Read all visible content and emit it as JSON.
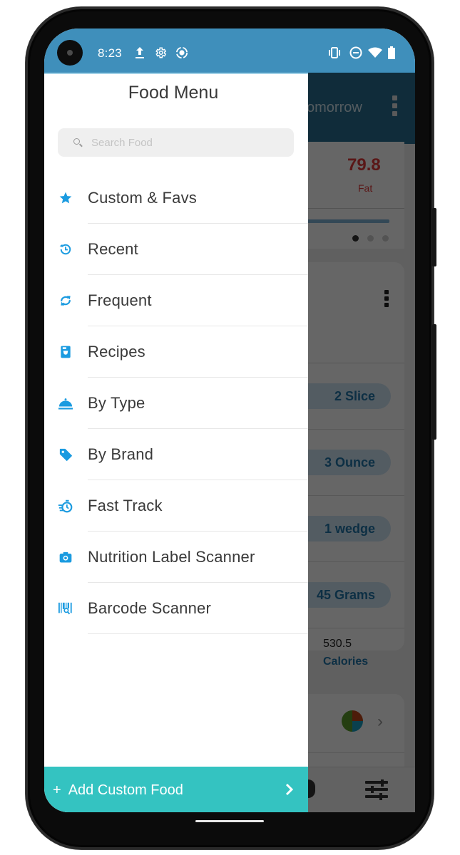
{
  "status_bar": {
    "time": "8:23",
    "left_icons": [
      "upload-icon",
      "settings-icon",
      "screen-record-icon"
    ],
    "right_icons": [
      "vibrate-icon",
      "do-not-disturb-icon",
      "wifi-icon",
      "battery-icon"
    ]
  },
  "background_app": {
    "header_text": "Tomorrow",
    "fat_value": "79.8",
    "fat_label": "Fat",
    "pager_dots": 3,
    "active_pager_dot": 0,
    "portions": [
      "2 Slice",
      "3 Ounce",
      "1 wedge",
      "45 Grams"
    ],
    "calories_value": "530.5",
    "calories_label": "Calories",
    "colors": {
      "fat": "#e23b3b",
      "accent": "#2277aa"
    }
  },
  "drawer": {
    "title": "Food Menu",
    "search": {
      "placeholder": "Search Food",
      "value": ""
    },
    "items": [
      {
        "label": "Custom & Favs",
        "icon": "star-icon"
      },
      {
        "label": "Recent",
        "icon": "history-icon"
      },
      {
        "label": "Frequent",
        "icon": "repeat-icon"
      },
      {
        "label": "Recipes",
        "icon": "recipe-book-icon"
      },
      {
        "label": "By Type",
        "icon": "food-cloche-icon"
      },
      {
        "label": "By Brand",
        "icon": "tag-icon"
      },
      {
        "label": "Fast Track",
        "icon": "stopwatch-icon"
      },
      {
        "label": "Nutrition Label Scanner",
        "icon": "camera-icon"
      },
      {
        "label": "Barcode Scanner",
        "icon": "barcode-icon"
      }
    ],
    "footer": {
      "plus": "+",
      "label": "Add Custom Food"
    },
    "colors": {
      "icon": "#1b9be0",
      "footer": "#34c3c1",
      "status_bar": "#3f8fbb"
    }
  }
}
